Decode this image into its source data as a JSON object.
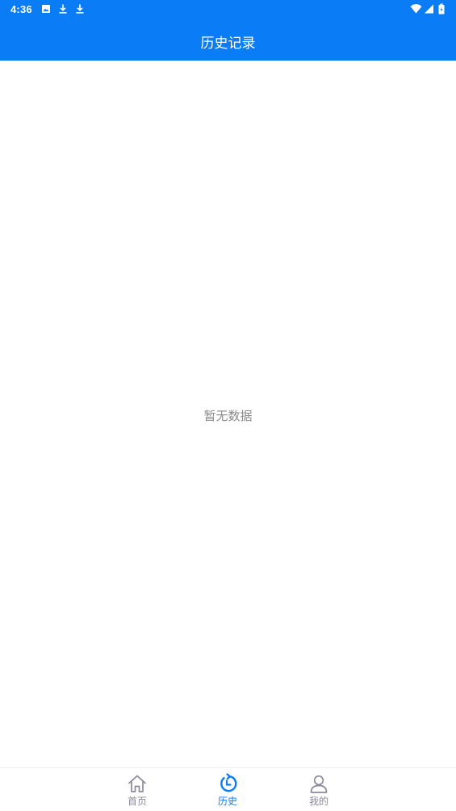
{
  "status_bar": {
    "time": "4:36",
    "icons": [
      "photo-icon",
      "download-icon",
      "download-icon",
      "wifi-icon",
      "signal-icon",
      "battery-icon"
    ]
  },
  "header": {
    "title": "历史记录"
  },
  "content": {
    "empty_message": "暂无数据"
  },
  "bottom_nav": {
    "items": [
      {
        "label": "首页",
        "icon": "home-icon",
        "active": false
      },
      {
        "label": "历史",
        "icon": "history-icon",
        "active": true
      },
      {
        "label": "我的",
        "icon": "user-icon",
        "active": false
      }
    ]
  },
  "colors": {
    "primary": "#0a7cf5",
    "inactive": "#8a8a9a",
    "muted_text": "#8a8a8a"
  }
}
